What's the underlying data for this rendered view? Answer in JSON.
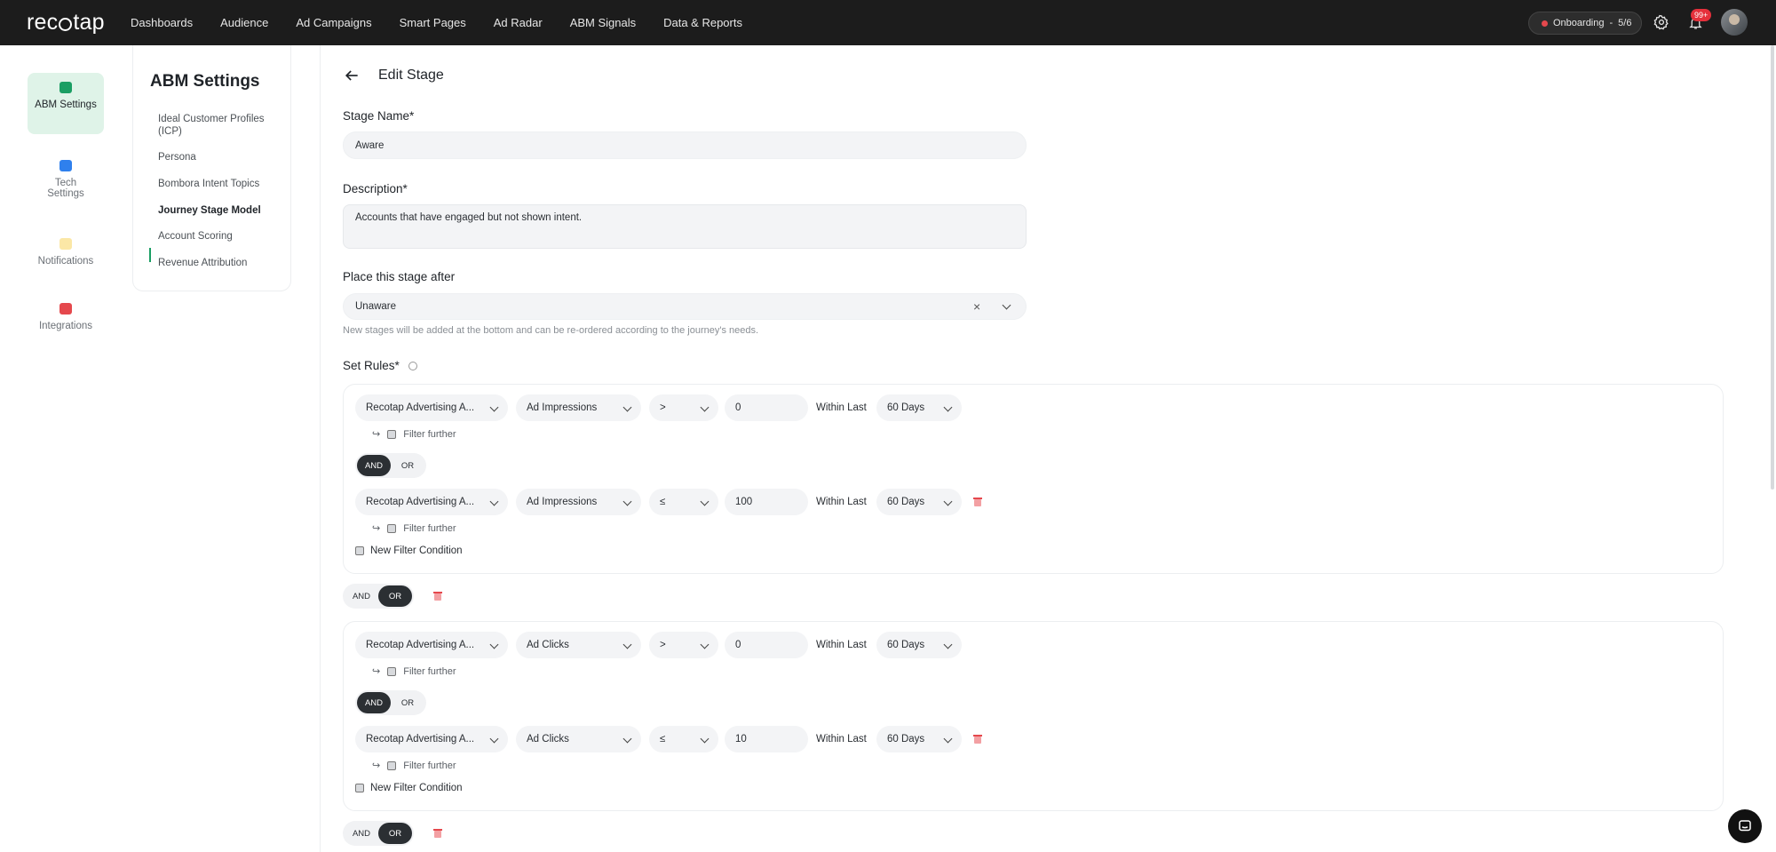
{
  "brand": {
    "name_prefix": "rec",
    "name_suffix": "tap"
  },
  "nav": [
    "Dashboards",
    "Audience",
    "Ad Campaigns",
    "Smart Pages",
    "Ad Radar",
    "ABM Signals",
    "Data & Reports"
  ],
  "onboarding": {
    "label": "Onboarding",
    "sep": "-",
    "progress": "5/6"
  },
  "notifications": {
    "badge": "99+"
  },
  "rail": [
    {
      "label": "ABM Settings",
      "icon": "abm-settings-icon",
      "color": "#1a9e63"
    },
    {
      "label": "Tech Settings",
      "icon": "tech-settings-icon",
      "color": "#2f80ed"
    },
    {
      "label": "Notifications",
      "icon": "notifications-icon",
      "color": "#f2c94c"
    },
    {
      "label": "Integrations",
      "icon": "integrations-icon",
      "color": "#e5484d"
    }
  ],
  "sidebar": {
    "title": "ABM Settings",
    "items": [
      "Ideal Customer Profiles (ICP)",
      "Persona",
      "Bombora Intent Topics",
      "Journey Stage Model",
      "Account Scoring",
      "Revenue Attribution"
    ],
    "active": "Journey Stage Model"
  },
  "form": {
    "title": "Edit Stage",
    "stage_name_label": "Stage Name*",
    "stage_name_value": "Aware",
    "description_label": "Description*",
    "description_value": "Accounts that have engaged but not shown intent.",
    "place_after_label": "Place this stage after",
    "place_after_value": "Unaware",
    "clear_symbol": "×",
    "place_after_hint": "New stages will be added at the bottom and can be re-ordered according to the journey's needs.",
    "rules_label": "Set Rules*"
  },
  "rules_ui": {
    "within_last": "Within Last",
    "filter_further": "Filter further",
    "new_filter_condition": "New Filter Condition",
    "and": "AND",
    "or": "OR"
  },
  "groups": [
    {
      "rows": [
        {
          "source": "Recotap Advertising A...",
          "metric": "Ad Impressions",
          "op": ">",
          "value": "0",
          "window": "60 Days"
        },
        {
          "source": "Recotap Advertising A...",
          "metric": "Ad Impressions",
          "op": "≤",
          "value": "100",
          "window": "60 Days"
        }
      ],
      "inner_join": "AND",
      "outer_join": "OR"
    },
    {
      "rows": [
        {
          "source": "Recotap Advertising A...",
          "metric": "Ad Clicks",
          "op": ">",
          "value": "0",
          "window": "60 Days"
        },
        {
          "source": "Recotap Advertising A...",
          "metric": "Ad Clicks",
          "op": "≤",
          "value": "10",
          "window": "60 Days"
        }
      ],
      "inner_join": "AND",
      "outer_join": "OR"
    }
  ],
  "colors": {
    "accent": "#1a9e63",
    "topbar": "#1c1c1c",
    "danger": "#e5484d"
  }
}
